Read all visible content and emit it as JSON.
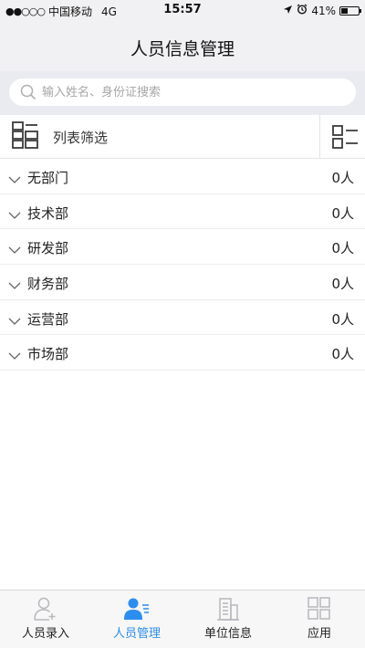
{
  "status": {
    "carrier": "中国移动",
    "network": "4G",
    "time": "15:57",
    "battery": "41%",
    "battery_level": 0.41
  },
  "header": {
    "title": "人员信息管理"
  },
  "search": {
    "placeholder": "输入姓名、身份证搜索"
  },
  "filter": {
    "label": "列表筛选"
  },
  "departments": [
    {
      "name": "无部门",
      "count": "0人"
    },
    {
      "name": "技术部",
      "count": "0人"
    },
    {
      "name": "研发部",
      "count": "0人"
    },
    {
      "name": "财务部",
      "count": "0人"
    },
    {
      "name": "运营部",
      "count": "0人"
    },
    {
      "name": "市场部",
      "count": "0人"
    }
  ],
  "tabs": [
    {
      "label": "人员录入",
      "icon": "person-add-icon",
      "active": false
    },
    {
      "label": "人员管理",
      "icon": "person-list-icon",
      "active": true
    },
    {
      "label": "单位信息",
      "icon": "building-icon",
      "active": false
    },
    {
      "label": "应用",
      "icon": "apps-grid-icon",
      "active": false
    }
  ],
  "colors": {
    "accent": "#2c8ef0",
    "inactive_icon": "#b7b7bd",
    "background": "#f1f1f3"
  }
}
